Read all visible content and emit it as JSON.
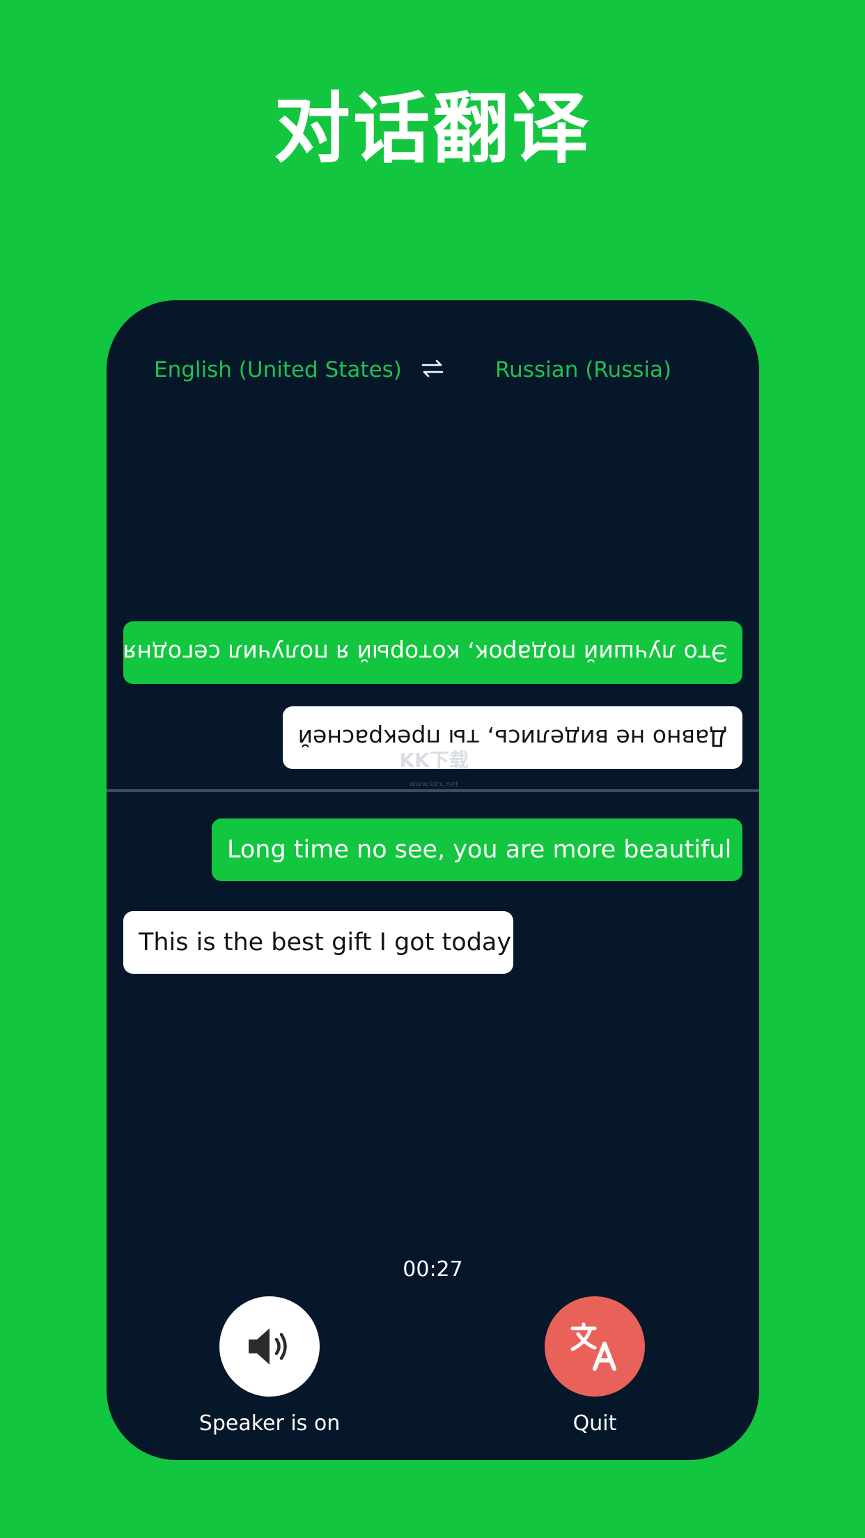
{
  "headline": "对话翻译",
  "languages": {
    "source": "English (United States)",
    "target": "Russian (Russia)",
    "swap_icon": "swap-arrows-icon"
  },
  "conversation": {
    "top_messages": [
      "Это лучший подарок, который я получил сегодня",
      "Давно не виделись, ты прекрасней"
    ],
    "bottom_messages": [
      "Long time no see, you are more beautiful",
      "This is the best gift I got today"
    ]
  },
  "watermark": {
    "main": "KK下载",
    "sub": "www.kkx.net"
  },
  "timer": "00:27",
  "controls": {
    "speaker_label": "Speaker is on",
    "speaker_icon": "speaker-icon",
    "quit_label": "Quit",
    "quit_icon": "translate-icon"
  },
  "colors": {
    "background": "#13c63f",
    "panel": "#07172a",
    "accent": "#13c63f",
    "quit_button": "#e9625a"
  }
}
